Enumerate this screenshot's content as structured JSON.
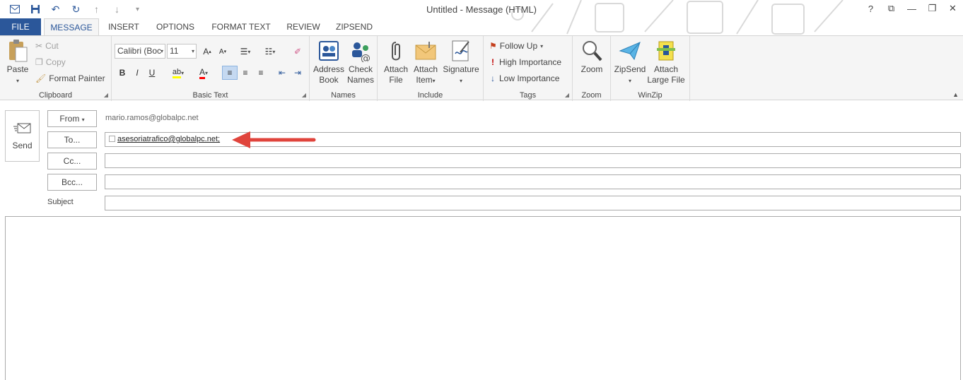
{
  "window": {
    "title": "Untitled - Message (HTML)",
    "controls": [
      "?",
      "⧉",
      "—",
      "❐",
      "✕"
    ]
  },
  "qat": {
    "icons": [
      "envelope-icon",
      "save-icon",
      "undo-icon",
      "redo-icon",
      "up-arrow-icon",
      "down-arrow-icon",
      "customize-icon"
    ]
  },
  "tabs": {
    "file": "FILE",
    "message": "MESSAGE",
    "insert": "INSERT",
    "options": "OPTIONS",
    "format_text": "FORMAT TEXT",
    "review": "REVIEW",
    "zipsend": "ZIPSEND"
  },
  "ribbon": {
    "clipboard": {
      "label": "Clipboard",
      "paste": "Paste",
      "cut": "Cut",
      "copy": "Copy",
      "format_painter": "Format Painter"
    },
    "basic_text": {
      "label": "Basic Text",
      "font": "Calibri (Boc",
      "size": "11",
      "bold": "B",
      "italic": "I",
      "underline": "U"
    },
    "names": {
      "label": "Names",
      "address_book_1": "Address",
      "address_book_2": "Book",
      "check_names_1": "Check",
      "check_names_2": "Names"
    },
    "include": {
      "label": "Include",
      "attach_file_1": "Attach",
      "attach_file_2": "File",
      "attach_item_1": "Attach",
      "attach_item_2": "Item",
      "signature": "Signature"
    },
    "tags": {
      "label": "Tags",
      "follow_up": "Follow Up",
      "high_importance": "High Importance",
      "low_importance": "Low Importance"
    },
    "zoom": {
      "label": "Zoom",
      "zoom": "Zoom"
    },
    "winzip": {
      "label": "WinZip",
      "zipsend": "ZipSend",
      "attach_large_1": "Attach",
      "attach_large_2": "Large File"
    }
  },
  "compose": {
    "send": "Send",
    "from_button": "From",
    "from_address": "mario.ramos@globalpc.net",
    "to_button": "To...",
    "to_value": "asesoriatrafico@globalpc.net;",
    "cc_button": "Cc...",
    "bcc_button": "Bcc...",
    "subject_label": "Subject"
  },
  "colors": {
    "accent": "#2b579a",
    "arrow": "#e0443c",
    "flag": "#c43e1c",
    "importance_high": "#c00000",
    "importance_low": "#2b579a"
  }
}
